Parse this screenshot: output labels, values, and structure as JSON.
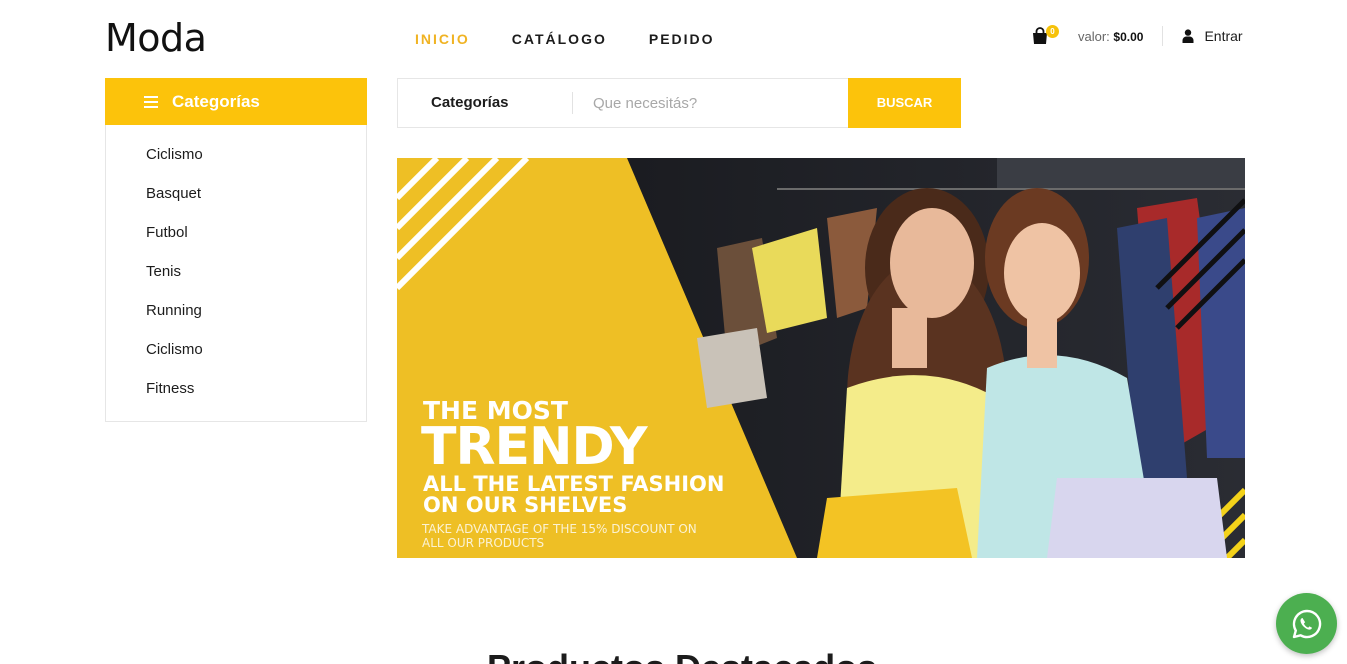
{
  "brand": {
    "logo": "Moda",
    "accent": "#fcc30b",
    "accent_text": "#f0b323"
  },
  "nav": {
    "items": [
      "INICIO",
      "CATÁLOGO",
      "PEDIDO"
    ],
    "active": "INICIO"
  },
  "header": {
    "cart_icon": "shopping-bag-icon",
    "cart_count": "0",
    "valor_label": "valor:",
    "valor_amount": "$0.00",
    "login_icon": "user-icon",
    "login_label": "Entrar"
  },
  "sidebar": {
    "title": "Categorías",
    "menu_icon": "hamburger-icon",
    "items": [
      "Ciclismo",
      "Basquet",
      "Futbol",
      "Tenis",
      "Running",
      "Ciclismo",
      "Fitness"
    ]
  },
  "search": {
    "category_label": "Categorías",
    "placeholder": "Que necesitás?",
    "button": "BUSCAR"
  },
  "hero": {
    "line1": "THE MOST",
    "line2": "TRENDY",
    "line3a": "ALL THE LATEST FASHION",
    "line3b": "ON OUR SHELVES",
    "line4a": "TAKE ADVANTAGE OF THE 15% DISCOUNT ON",
    "line4b": "ALL OUR PRODUCTS"
  },
  "section": {
    "title": "Productos Destacados"
  },
  "whatsapp_icon": "whatsapp-icon"
}
